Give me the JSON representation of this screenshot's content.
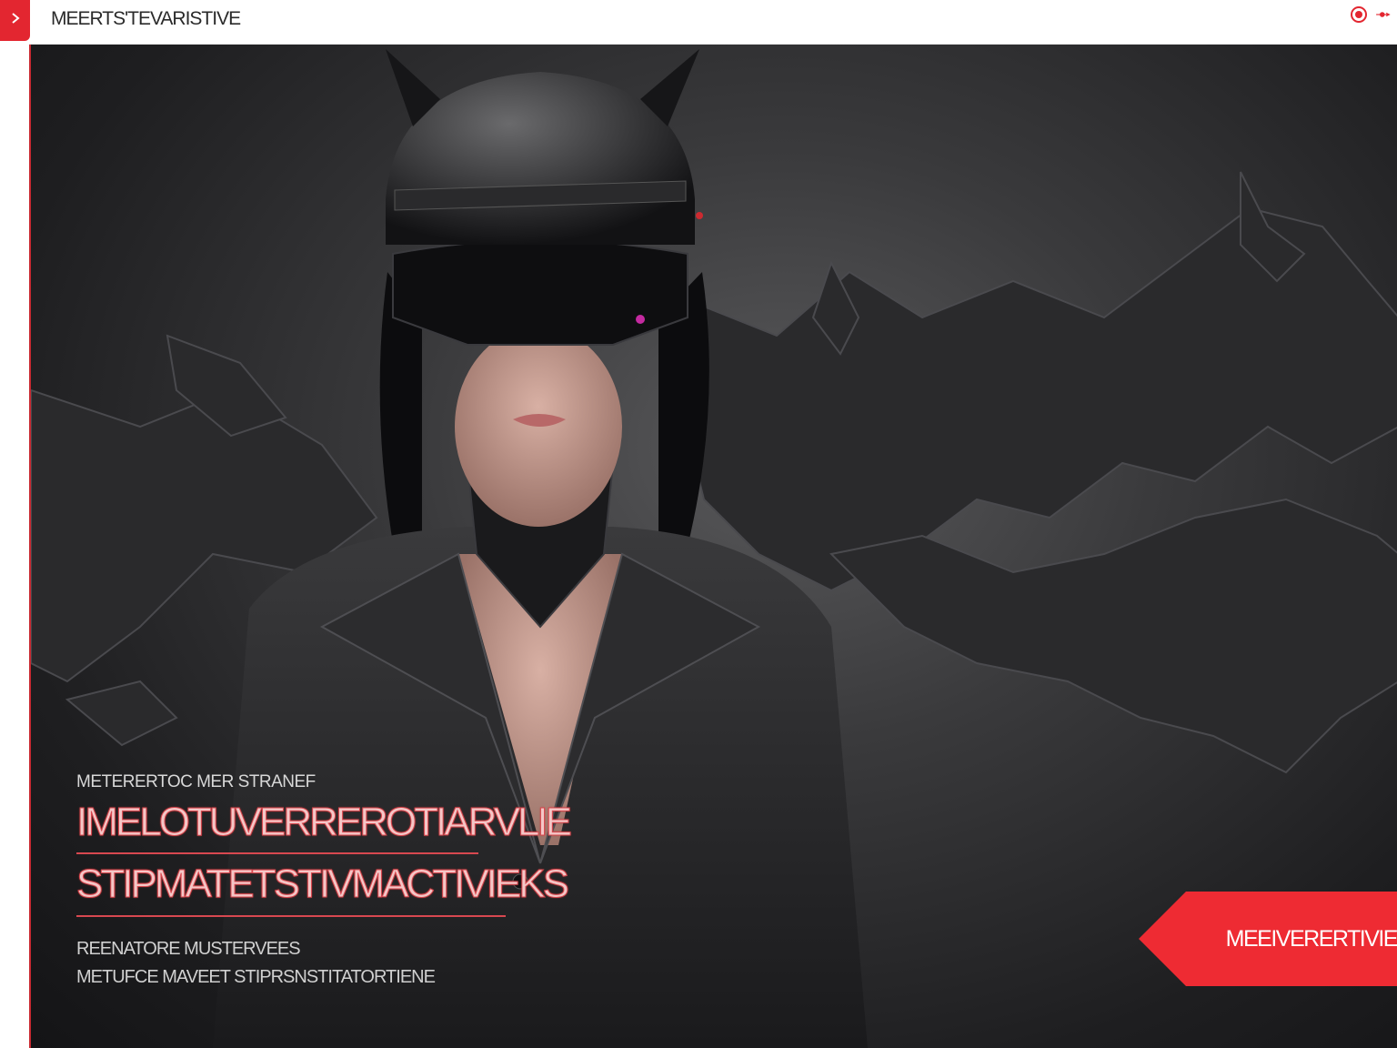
{
  "topbar": {
    "title": "MEERTS'TEVARISTIVE",
    "icons": [
      "chevron-right-icon",
      "record-icon",
      "cursor-arrow-icon"
    ]
  },
  "hero": {
    "eyebrow": "METERERTOC MER STRANEF",
    "headline": "IMELOTUVERREROTIARVLIE",
    "headline2": "STIPMATETSTIVMACTIVIEKS",
    "body_line1": "REENATORE MUSTERVEES",
    "body_line2": "METUFCE MAVEET STIPRSNSTITATORTIENE",
    "cta_label": "MEEIVERERTIVIE",
    "accent_color": "#ee2b33"
  }
}
